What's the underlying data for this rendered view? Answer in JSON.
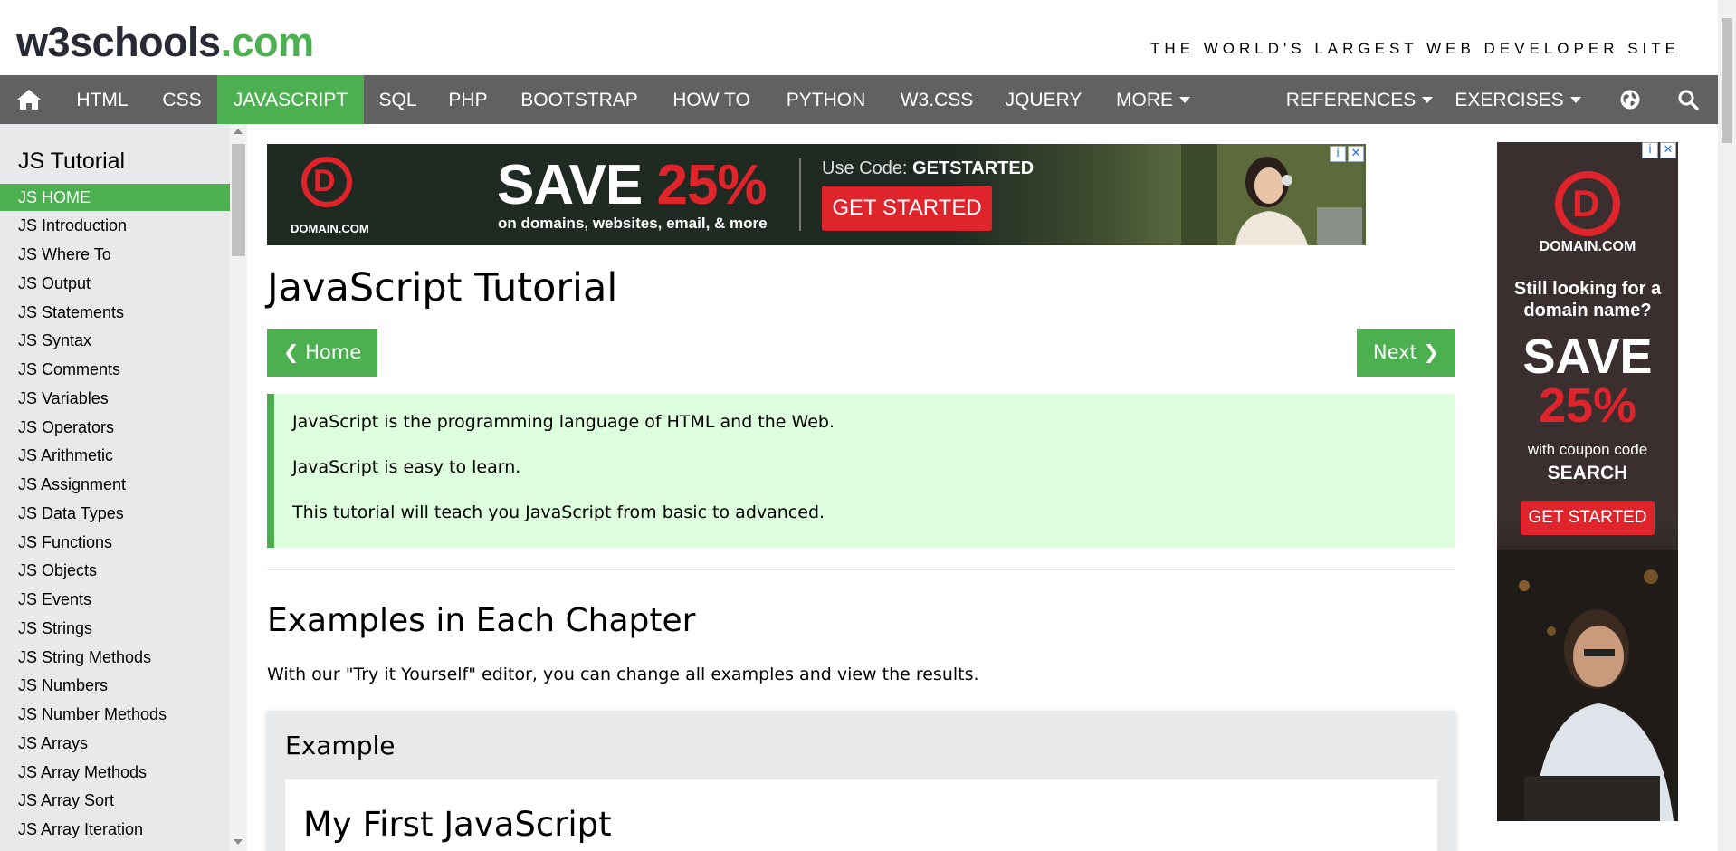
{
  "header": {
    "logo_main": "w3schools",
    "logo_dot": ".com",
    "tagline": "THE WORLD'S LARGEST WEB DEVELOPER SITE"
  },
  "nav": {
    "items": [
      "HTML",
      "CSS",
      "JAVASCRIPT",
      "SQL",
      "PHP",
      "BOOTSTRAP",
      "HOW TO",
      "PYTHON",
      "W3.CSS",
      "JQUERY",
      "MORE"
    ],
    "active": "JAVASCRIPT",
    "right_items": [
      "REFERENCES",
      "EXERCISES"
    ],
    "icons": [
      "home-icon",
      "globe-icon",
      "search-icon"
    ]
  },
  "sidebar": {
    "title": "JS Tutorial",
    "items": [
      "JS HOME",
      "JS Introduction",
      "JS Where To",
      "JS Output",
      "JS Statements",
      "JS Syntax",
      "JS Comments",
      "JS Variables",
      "JS Operators",
      "JS Arithmetic",
      "JS Assignment",
      "JS Data Types",
      "JS Functions",
      "JS Objects",
      "JS Events",
      "JS Strings",
      "JS String Methods",
      "JS Numbers",
      "JS Number Methods",
      "JS Arrays",
      "JS Array Methods",
      "JS Array Sort",
      "JS Array Iteration"
    ],
    "active_index": 0
  },
  "ad_banner": {
    "brand": "DOMAIN.COM",
    "save": "SAVE",
    "percent": "25%",
    "sub": "on domains, websites, email, & more",
    "code_label": "Use Code:",
    "code": "GETSTARTED",
    "button": "GET STARTED"
  },
  "main": {
    "title": "JavaScript Tutorial",
    "prev_button": "❮ Home",
    "next_button": "Next ❯",
    "intro": [
      "JavaScript is the programming language of HTML and the Web.",
      "JavaScript is easy to learn.",
      "This tutorial will teach you JavaScript from basic to advanced."
    ],
    "section_title": "Examples in Each Chapter",
    "section_text": "With our \"Try it Yourself\" editor, you can change all examples and view the results.",
    "example_label": "Example",
    "example_heading": "My First JavaScript"
  },
  "right_ad": {
    "brand": "DOMAIN.COM",
    "line1": "Still looking for a",
    "line2": "domain name?",
    "save": "SAVE",
    "percent": "25%",
    "coupon": "with coupon code",
    "code": "SEARCH",
    "button": "GET STARTED"
  },
  "colors": {
    "brand_green": "#4CAF50",
    "nav_bg": "#616161",
    "sidebar_bg": "#E7E9EB",
    "intro_bg": "#DDFFDD",
    "ad_red": "#e0242b"
  }
}
